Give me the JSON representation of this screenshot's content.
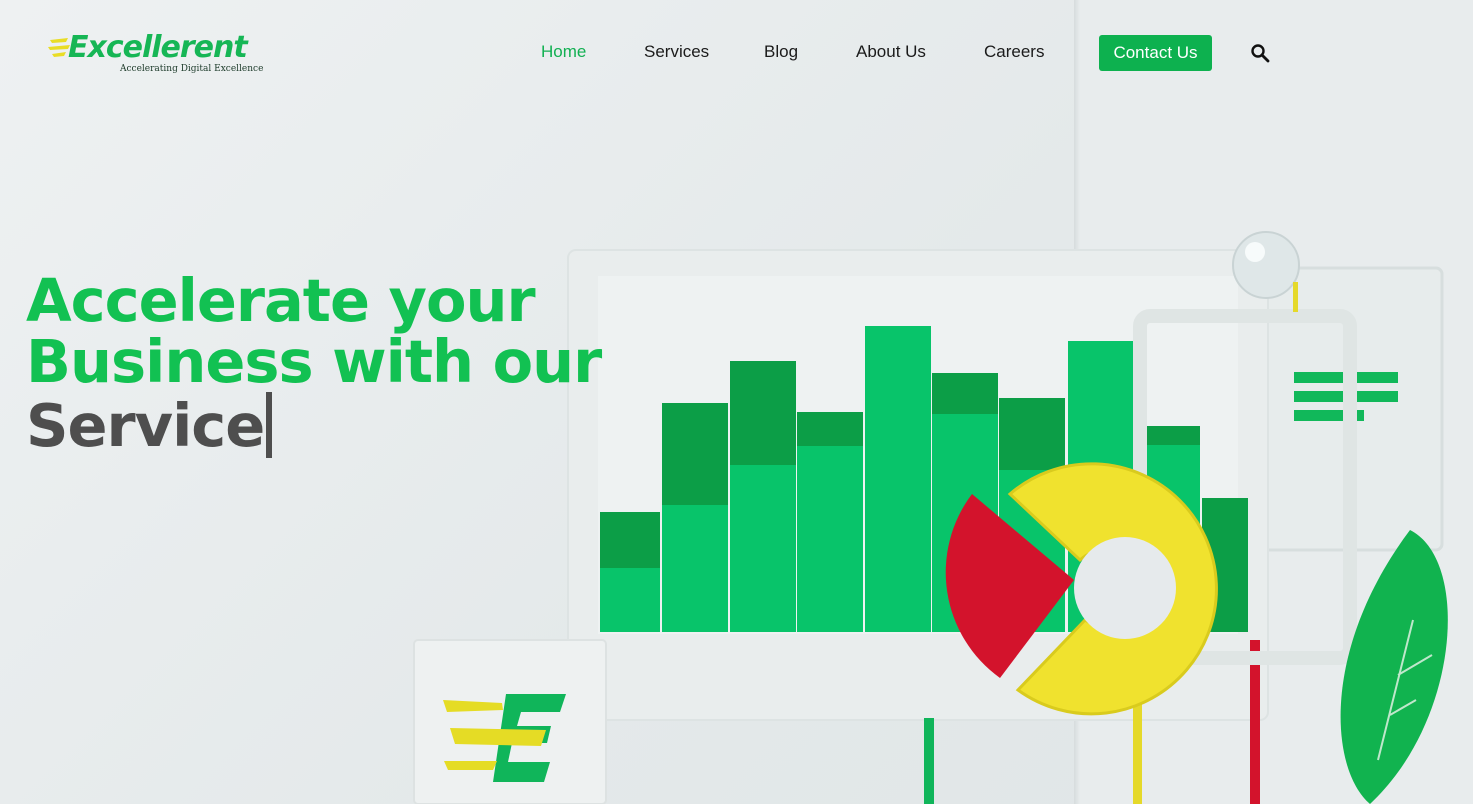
{
  "brand": {
    "name": "Excellerent",
    "tagline": "Accelerating Digital Excellence",
    "accent_color": "#12b052"
  },
  "nav": {
    "items": [
      {
        "label": "Home",
        "active": true
      },
      {
        "label": "Services",
        "active": false
      },
      {
        "label": "Blog",
        "active": false
      },
      {
        "label": "About Us",
        "active": false
      },
      {
        "label": "Careers",
        "active": false
      }
    ],
    "cta_label": "Contact Us",
    "search_icon": "search-icon"
  },
  "hero": {
    "line1": "Accelerate your",
    "line2": "Business with our",
    "typed_word": "Service"
  }
}
